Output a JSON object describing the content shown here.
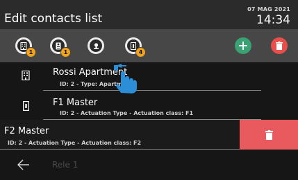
{
  "header": {
    "title": "Edit contacts list",
    "date": "07 MAG 2021",
    "time": "14:34"
  },
  "toolbar": {
    "filters": [
      {
        "icon": "apartment-icon",
        "count": "1"
      },
      {
        "icon": "outdoor-station-icon",
        "count": "1"
      },
      {
        "icon": "camera-icon",
        "count": ""
      },
      {
        "icon": "actuator-icon",
        "count": "4"
      }
    ],
    "add_icon": "plus-icon",
    "delete_icon": "trash-icon"
  },
  "contacts": [
    {
      "name": "Rossi Apartment",
      "detail": "ID: 2 - Type: Apartment",
      "icon": "apartment-icon"
    },
    {
      "name": "F1 Master",
      "detail": "ID: 2 - Actuation Type - Actuation class: F1",
      "icon": "actuator-icon"
    }
  ],
  "swiped": {
    "name": "F2 Master",
    "detail": "ID: 2 - Actuation Type - Actuation class: F2"
  },
  "ghost_item": {
    "name": "Rele 1"
  },
  "colors": {
    "accent_orange": "#f2a21b",
    "add_green": "#3aa173",
    "delete_red": "#e85a5e"
  }
}
